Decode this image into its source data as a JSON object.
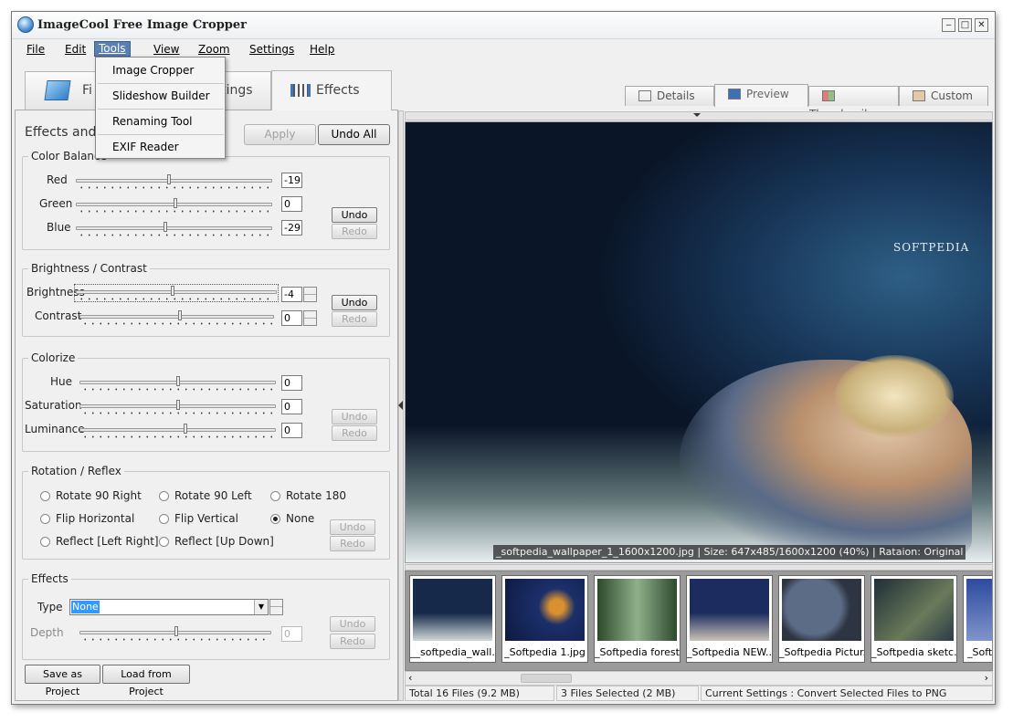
{
  "window": {
    "title": "ImageCool Free Image Cropper"
  },
  "menu": [
    "File",
    "Edit",
    "Tools",
    "View",
    "Zoom",
    "Settings",
    "Help"
  ],
  "tools_menu": [
    "Image Cropper",
    "Slideshow Builder",
    "Renaming Tool",
    "EXIF Reader"
  ],
  "main_tabs": {
    "files": "Fi",
    "settings": "ettings",
    "effects": "Effects"
  },
  "view_tabs": [
    "Details",
    "Preview",
    "Thumbnails",
    "Custom"
  ],
  "effects_panel": {
    "title": "Effects and",
    "apply": "Apply",
    "undo_all": "Undo All",
    "color_balance": {
      "title": "Color Balance",
      "labels": [
        "Red",
        "Green",
        "Blue"
      ],
      "values": [
        "-19",
        "0",
        "-29"
      ],
      "undo": "Undo",
      "redo": "Redo"
    },
    "brightness_contrast": {
      "title": "Brightness / Contrast",
      "labels": [
        "Brightness",
        "Contrast"
      ],
      "values": [
        "-4",
        "0"
      ],
      "undo": "Undo",
      "redo": "Redo"
    },
    "colorize": {
      "title": "Colorize",
      "labels": [
        "Hue",
        "Saturation",
        "Luminance"
      ],
      "values": [
        "0",
        "0",
        "0"
      ],
      "undo": "Undo",
      "redo": "Redo"
    },
    "rotation": {
      "title": "Rotation / Reflex",
      "options": [
        "Rotate 90 Right",
        "Rotate 90 Left",
        "Rotate 180",
        "Flip Horizontal",
        "Flip Vertical",
        "None",
        "Reflect [Left Right]",
        "Reflect [Up Down]"
      ],
      "selected": "None",
      "undo": "Undo",
      "redo": "Redo"
    },
    "effects": {
      "title": "Effects",
      "type_label": "Type",
      "type_value": "None",
      "depth_label": "Depth",
      "depth_value": "0",
      "undo": "Undo",
      "redo": "Redo"
    },
    "save_project": "Save as Project",
    "load_project": "Load from Project"
  },
  "preview": {
    "caption": "_softpedia_wallpaper_1_1600x1200.jpg  |  Size: 647x485/1600x1200 (40%)  |  Rataion: Original",
    "logo": "SOFTPEDIA"
  },
  "thumbnails": [
    "__softpedia_wall...",
    "_Softpedia 1.jpg",
    "_Softpedia forest...",
    "_Softpedia NEW...",
    "_Softpedia Pictur...",
    "_Softpedia sketc...",
    "_Soft"
  ],
  "status": {
    "total": "Total 16 Files (9.2 MB)",
    "selected": "3 Files Selected (2 MB)",
    "settings": "Current Settings : Convert Selected Files to PNG"
  }
}
